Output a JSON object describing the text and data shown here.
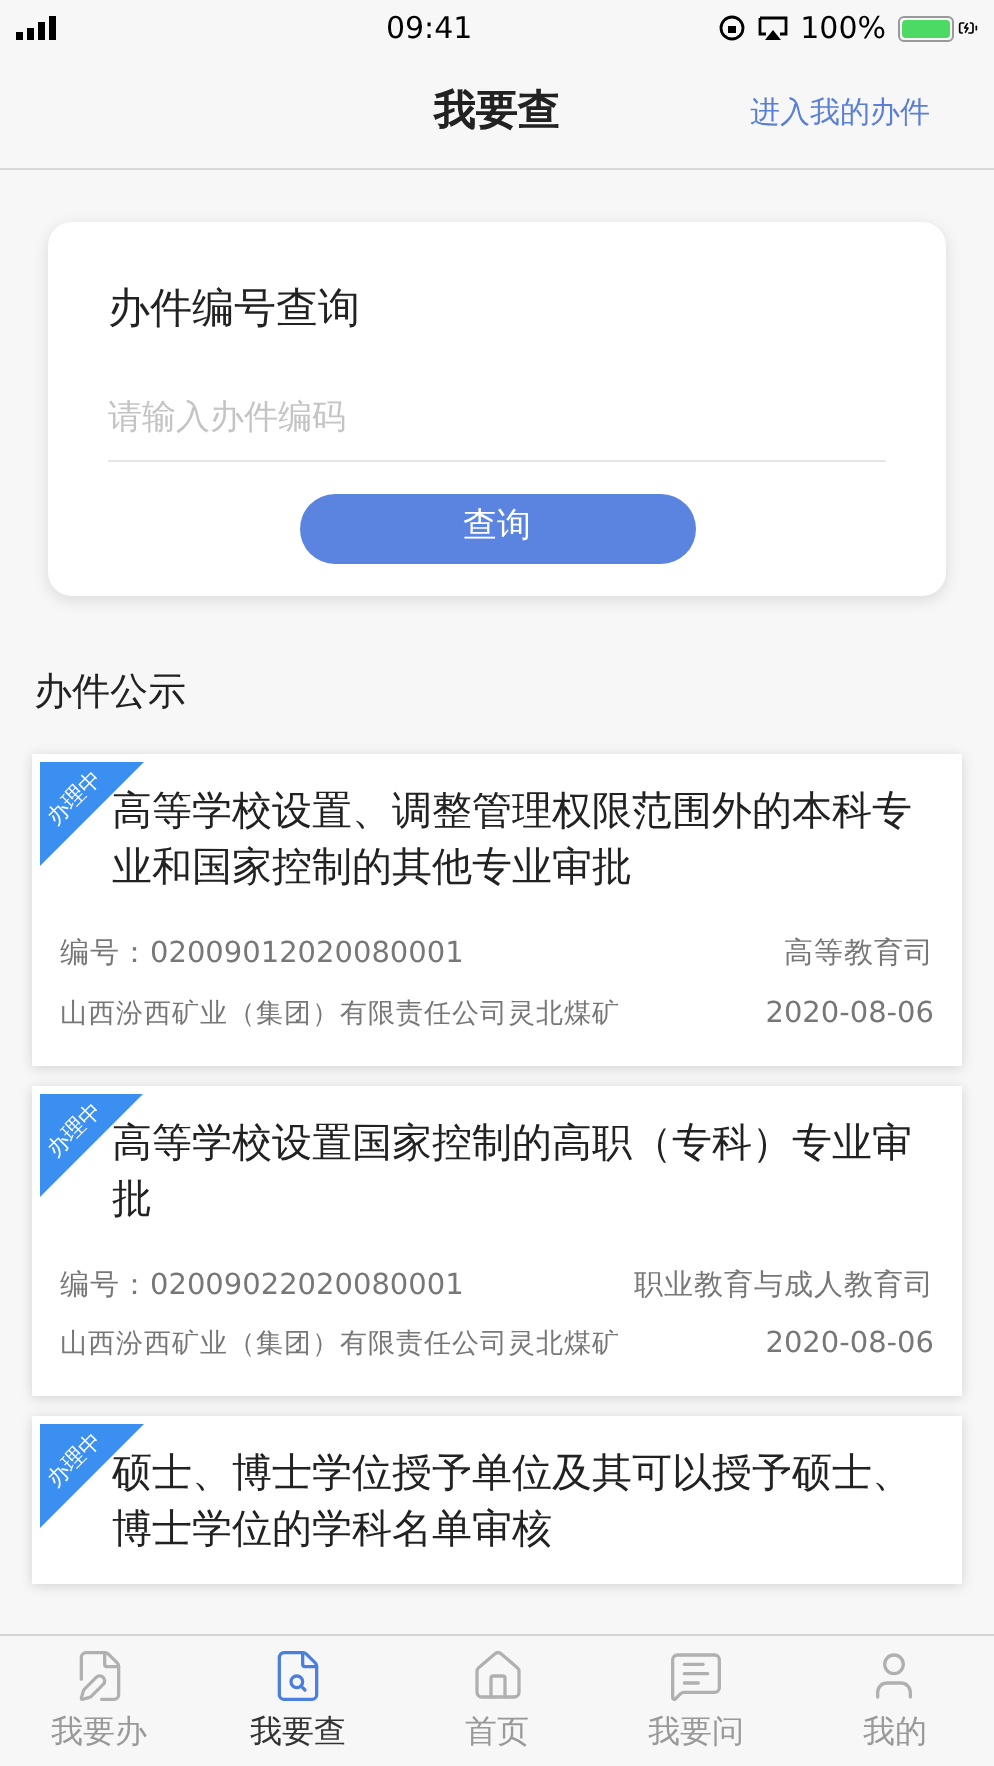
{
  "status_bar": {
    "time": "09:41",
    "battery": "100%"
  },
  "nav": {
    "title": "我要查",
    "action": "进入我的办件"
  },
  "query_card": {
    "title": "办件编号查询",
    "placeholder": "请输入办件编码",
    "button": "查询"
  },
  "section_title": "办件公示",
  "items": [
    {
      "status": "办理中",
      "title": "高等学校设置、调整管理权限范围外的本科专业和国家控制的其他专业审批",
      "number": "编号：02009012020080001",
      "department": "高等教育司",
      "applicant": "山西汾西矿业（集团）有限责任公司灵北煤矿",
      "date": "2020-08-06"
    },
    {
      "status": "办理中",
      "title": "高等学校设置国家控制的高职（专科）专业审批",
      "number": "编号：02009022020080001",
      "department": "职业教育与成人教育司",
      "applicant": "山西汾西矿业（集团）有限责任公司灵北煤矿",
      "date": "2020-08-06"
    },
    {
      "status": "办理中",
      "title": "硕士、博士学位授予单位及其可以授予硕士、博士学位的学科名单审核"
    }
  ],
  "tabs": [
    {
      "kind": "handle",
      "label": "我要办",
      "selected": false
    },
    {
      "kind": "search",
      "label": "我要查",
      "selected": true
    },
    {
      "kind": "home",
      "label": "首页",
      "selected": false
    },
    {
      "kind": "ask",
      "label": "我要问",
      "selected": false
    },
    {
      "kind": "mine",
      "label": "我的",
      "selected": false
    }
  ]
}
